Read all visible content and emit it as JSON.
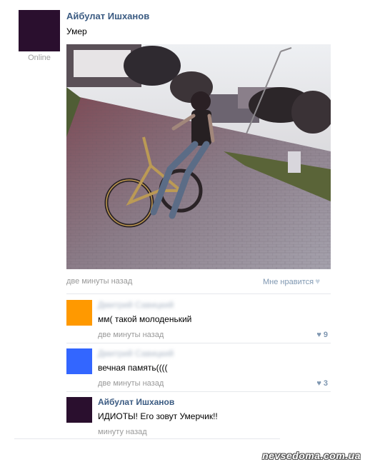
{
  "post": {
    "author": "Айбулат Ишханов",
    "status": "Online",
    "text": "Умер",
    "time": "две минуты назад",
    "like_label": "Мне нравится",
    "avatar_color": "#2a0f2e"
  },
  "comments": [
    {
      "author": "Дмитрий Савицкий",
      "author_blurred": true,
      "text": "мм( такой молоденький",
      "time": "две минуты назад",
      "likes": "9",
      "avatar_color": "#ff9900"
    },
    {
      "author": "Дмитрий Савицкий",
      "author_blurred": true,
      "text": "вечная память((((",
      "time": "две минуты назад",
      "likes": "3",
      "avatar_color": "#3366ff"
    },
    {
      "author": "Айбулат Ишханов",
      "author_blurred": false,
      "text": "ИДИОТЫ! Его зовут Умерчик!!",
      "time": "минуту назад",
      "avatar_color": "#2a0f2e"
    }
  ],
  "watermark": "nevsedoma.com.ua",
  "icons": {
    "like": "heart-icon"
  },
  "colors": {
    "link": "#3b5b82",
    "muted": "#999999",
    "accent_like": "#7f97b1"
  }
}
